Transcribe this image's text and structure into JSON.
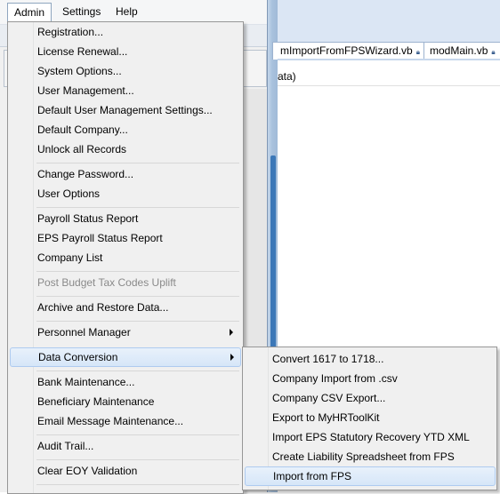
{
  "menubar": {
    "items": [
      "Admin",
      "Settings",
      "Help"
    ]
  },
  "tabs": [
    {
      "label": "mImportFromFPSWizard.vb"
    },
    {
      "label": "modMain.vb"
    }
  ],
  "code_fragment": "ata)",
  "admin_menu": {
    "items": [
      {
        "label": "Registration..."
      },
      {
        "label": "License Renewal..."
      },
      {
        "label": "System Options..."
      },
      {
        "label": "User Management..."
      },
      {
        "label": "Default User Management Settings..."
      },
      {
        "label": "Default Company..."
      },
      {
        "label": "Unlock all Records"
      },
      {
        "label": "Change Password..."
      },
      {
        "label": "User Options"
      },
      {
        "label": "Payroll Status Report"
      },
      {
        "label": "EPS Payroll Status Report"
      },
      {
        "label": "Company List"
      },
      {
        "label": "Post Budget Tax Codes Uplift"
      },
      {
        "label": "Archive and Restore Data..."
      },
      {
        "label": "Personnel Manager"
      },
      {
        "label": "Data Conversion"
      },
      {
        "label": "Bank Maintenance..."
      },
      {
        "label": "Beneficiary Maintenance"
      },
      {
        "label": "Email Message Maintenance..."
      },
      {
        "label": "Audit Trail..."
      },
      {
        "label": "Clear EOY Validation"
      }
    ]
  },
  "data_conversion_submenu": {
    "items": [
      {
        "label": "Convert 1617 to 1718..."
      },
      {
        "label": "Company Import from .csv"
      },
      {
        "label": "Company CSV Export..."
      },
      {
        "label": "Export to MyHRToolKit"
      },
      {
        "label": "Import EPS Statutory Recovery YTD XML"
      },
      {
        "label": "Create Liability Spreadsheet from FPS"
      },
      {
        "label": "Import from FPS"
      }
    ]
  },
  "colors": {
    "highlight": "#d6e6f8",
    "highlight_border": "#aecbf0",
    "disabled_text": "#8a8a8a",
    "menu_bg": "#f0f0f0"
  }
}
